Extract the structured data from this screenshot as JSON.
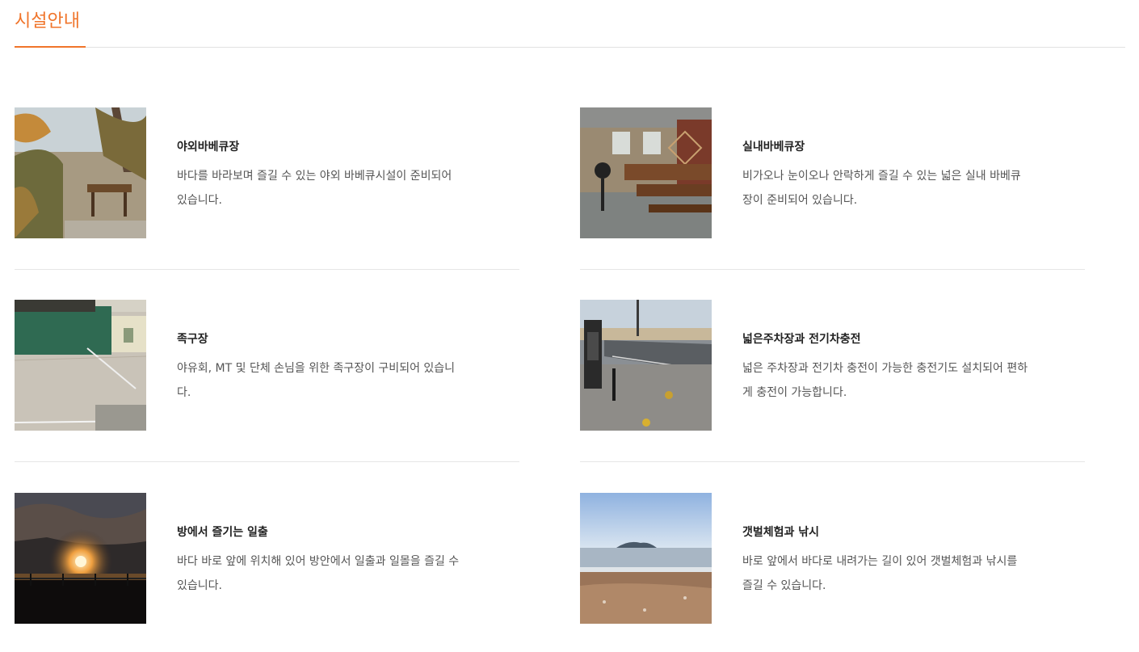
{
  "page": {
    "title": "시설안내"
  },
  "facilities": [
    {
      "title": "야외바베큐장",
      "desc": "바다를 바라보며 즐길 수 있는 야외 바베큐시설이 준비되어 있습니다.",
      "photo_icon": "outdoor-bbq-photo"
    },
    {
      "title": "실내바베큐장",
      "desc": "비가오나 눈이오나 안락하게 즐길 수 있는 넓은 실내 바베큐장이 준비되어 있습니다.",
      "photo_icon": "indoor-bbq-photo"
    },
    {
      "title": "족구장",
      "desc": "야유회, MT 및 단체 손님을 위한 족구장이 구비되어 있습니다.",
      "photo_icon": "jokgu-court-photo"
    },
    {
      "title": "넓은주차장과 전기차충전",
      "desc": "넓은 주차장과 전기차 충전이 가능한 충전기도 설치되어 편하게 충전이 가능합니다.",
      "photo_icon": "parking-ev-photo"
    },
    {
      "title": "방에서 즐기는 일출",
      "desc": "바다 바로 앞에 위치해 있어 방안에서 일출과 일몰을 즐길 수 있습니다.",
      "photo_icon": "sunrise-photo"
    },
    {
      "title": "갯벌체험과 낚시",
      "desc": "바로 앞에서 바다로 내려가는 길이 있어 갯벌체험과 낚시를 즐길 수 있습니다.",
      "photo_icon": "tidal-flat-photo"
    }
  ],
  "colors": {
    "accent": "#f0742a",
    "divider": "#e6e6e6",
    "title_text": "#222222",
    "desc_text": "#555555"
  }
}
